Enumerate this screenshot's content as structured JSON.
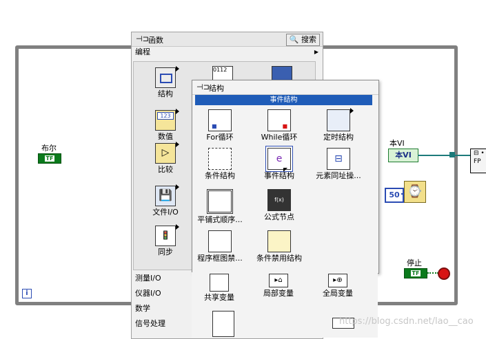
{
  "diagram": {
    "bool_label": "布尔",
    "bool_ctl_text": "TF",
    "vi_label": "本VI",
    "vi_ref_text": "本VI",
    "num_const": "50",
    "stop_label": "停止",
    "stop_ctl_text": "TF",
    "iter_text": "i",
    "fp_text": "FP",
    "watermark": "https://blog.csdn.net/lao__cao"
  },
  "functions_palette": {
    "title": "函数",
    "search_label": "搜索",
    "category": "编程",
    "items": [
      {
        "label": "结构",
        "icon": "structures-icon"
      },
      {
        "label": "数值",
        "icon": "numeric-icon"
      },
      {
        "label": "比较",
        "icon": "comparison-icon"
      },
      {
        "label": "文件I/O",
        "icon": "file-io-icon"
      },
      {
        "label": "同步",
        "icon": "synchronization-icon"
      }
    ],
    "categories": [
      "测量I/O",
      "仪器I/O",
      "数学",
      "信号处理"
    ]
  },
  "structures_palette": {
    "title": "结构",
    "tooltip": "事件结构",
    "items": [
      {
        "label": "For循环",
        "icon": "for-loop-icon"
      },
      {
        "label": "While循环",
        "icon": "while-loop-icon"
      },
      {
        "label": "定时结构",
        "icon": "timed-structure-icon"
      },
      {
        "label": "条件结构",
        "icon": "case-structure-icon"
      },
      {
        "label": "事件结构",
        "icon": "event-structure-icon"
      },
      {
        "label": "元素同址操...",
        "icon": "in-place-element-icon"
      },
      {
        "label": "平铺式顺序...",
        "icon": "flat-sequence-icon"
      },
      {
        "label": "公式节点",
        "icon": "formula-node-icon"
      },
      {
        "label": "程序框图禁...",
        "icon": "diagram-disable-icon"
      },
      {
        "label": "条件禁用结构",
        "icon": "conditional-disable-icon"
      },
      {
        "label": "共享变量",
        "icon": "shared-variable-icon"
      },
      {
        "label": "局部变量",
        "icon": "local-variable-icon"
      },
      {
        "label": "全局变量",
        "icon": "global-variable-icon"
      }
    ]
  },
  "colors": {
    "wire_gray": "#808080",
    "bool_green": "#0b7a1c",
    "highlight_blue": "#1f5cb8",
    "ref_teal": "#1c7a7a"
  }
}
